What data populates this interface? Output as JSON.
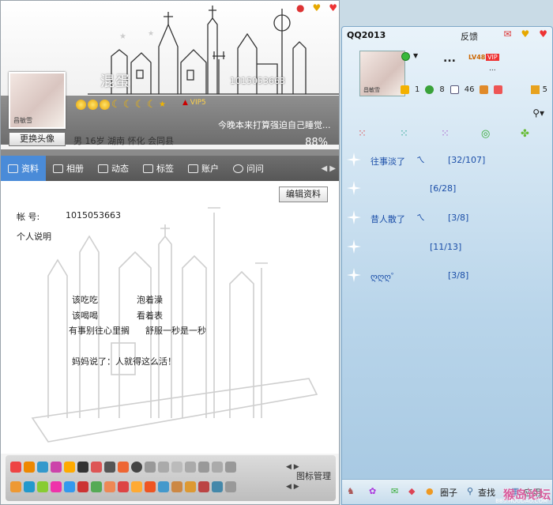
{
  "profile": {
    "window_icons": [
      "notification-icon",
      "skin-icon",
      "heart-icon"
    ],
    "nickname": "混蛋",
    "qq_number": "1015053663",
    "change_avatar_label": "更换头像",
    "avatar_signature": "昌敏雪",
    "vip_label": "VIP5",
    "signature": "今晚本来打算强迫自己睡觉...",
    "info": "男  16岁   湖南 怀化 会同县",
    "completion": "88%",
    "tabs": [
      {
        "label": "资料",
        "icon": "profile-card-icon"
      },
      {
        "label": "相册",
        "icon": "photo-album-icon"
      },
      {
        "label": "动态",
        "icon": "feed-list-icon"
      },
      {
        "label": "标签",
        "icon": "tag-icon"
      },
      {
        "label": "账户",
        "icon": "wallet-icon"
      },
      {
        "label": "问问",
        "icon": "question-icon"
      }
    ],
    "edit_label": "编辑资料",
    "account_label": "帐    号:",
    "account_value": "1015053663",
    "intro_label": "个人说明",
    "poem": {
      "line1a": "该吃吃",
      "line1b": "泡着澡",
      "line2a": "该喝喝",
      "line2b": "看着表",
      "line3a": "有事别往心里搁",
      "line3b": "舒服一秒是一秒",
      "line4": "妈妈说了：人就得这么活！"
    },
    "icon_manager_label": "图标管理"
  },
  "qq": {
    "title": "QQ2013",
    "feedback_label": "反馈",
    "nickname": "...",
    "signature": "...",
    "level_label": "LV48",
    "vip_label": "VIP",
    "avatar_signature": "昌敏雪",
    "stats": [
      {
        "icon": "star-icon",
        "value": "1"
      },
      {
        "icon": "zone-icon",
        "value": "8"
      },
      {
        "icon": "mail-icon",
        "value": "46"
      },
      {
        "icon": "pet-icon",
        "value": ""
      }
    ],
    "right_count": "5",
    "groups": [
      {
        "name": "往事淡了",
        "emoticon": "ㄟ",
        "count": "[32/107]"
      },
      {
        "name": "",
        "emoticon": "",
        "count": "[6/28]"
      },
      {
        "name": "昔人散了",
        "emoticon": "ㄟ",
        "count": "[3/8]"
      },
      {
        "name": "",
        "emoticon": "",
        "count": "[11/13]"
      },
      {
        "name": "ღღღ゜",
        "emoticon": "",
        "count": "[3/8]"
      }
    ],
    "bottom": {
      "circle_label": "圈子",
      "search_label": "查找",
      "apps_label": "应用"
    },
    "watermark": "猴岛论坛",
    "watermark_sub": "BBS.HOUDAO.COM"
  },
  "colors": {
    "tab_active": "#4a8bd8",
    "group_text": "#1b4ea8",
    "gray_band": "#7c7c7c"
  }
}
